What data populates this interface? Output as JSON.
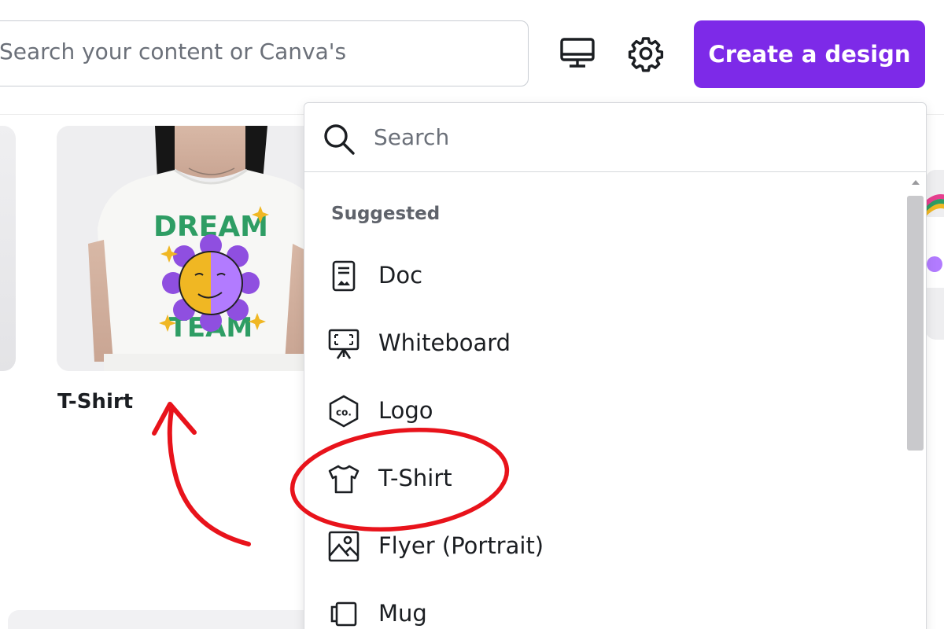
{
  "header": {
    "search_placeholder": "Search your content or Canva's",
    "create_button_label": "Create a design",
    "icons": {
      "monitor": "desktop-monitor-icon",
      "settings": "gear-icon"
    }
  },
  "templates": {
    "tshirt_card_title": "T-Shirt",
    "tshirt_print": {
      "top_text": "DREAM",
      "bottom_text": "TEAM"
    }
  },
  "dropdown": {
    "search_placeholder": "Search",
    "section_label": "Suggested",
    "items": [
      {
        "label": "Doc",
        "icon": "doc-icon"
      },
      {
        "label": "Whiteboard",
        "icon": "whiteboard-icon"
      },
      {
        "label": "Logo",
        "icon": "logo-co-icon"
      },
      {
        "label": "T-Shirt",
        "icon": "tshirt-icon"
      },
      {
        "label": "Flyer (Portrait)",
        "icon": "image-icon"
      },
      {
        "label": "Mug",
        "icon": "mug-icon"
      }
    ]
  },
  "colors": {
    "accent": "#7d2ae8",
    "annotation": "#e8131b"
  }
}
